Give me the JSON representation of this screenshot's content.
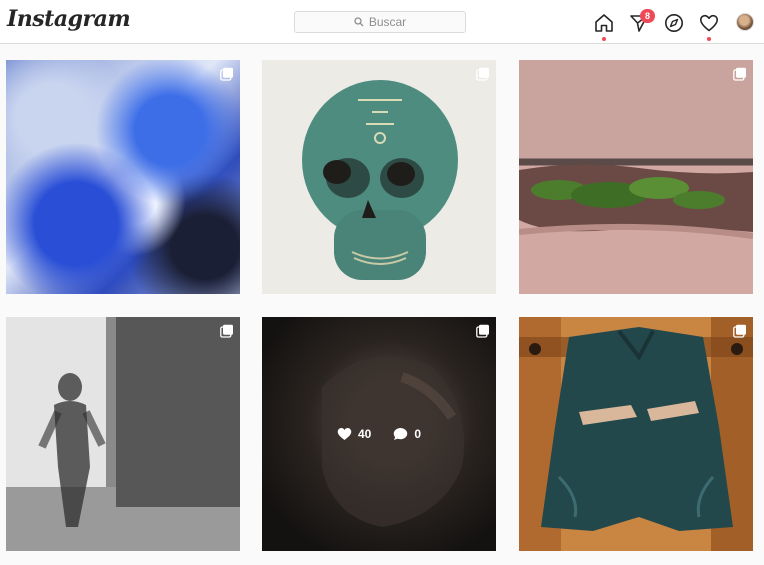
{
  "app": {
    "logo": "Instagram"
  },
  "search": {
    "placeholder": "Buscar"
  },
  "nav": {
    "messages_badge": "8"
  },
  "posts": [
    {
      "description": "blue marbled abstract art",
      "multi": true
    },
    {
      "description": "green clay skull",
      "multi": true
    },
    {
      "description": "herbs between skin folds",
      "multi": true
    },
    {
      "description": "blurred figure in black and white",
      "multi": true
    },
    {
      "description": "dark hands on shoulder",
      "multi": true,
      "likes": "40",
      "comments": "0"
    },
    {
      "description": "denim jacket with painted hands",
      "multi": true
    }
  ],
  "colors": {
    "accent": "#ed4956",
    "border": "#dbdbdb",
    "text": "#262626"
  }
}
